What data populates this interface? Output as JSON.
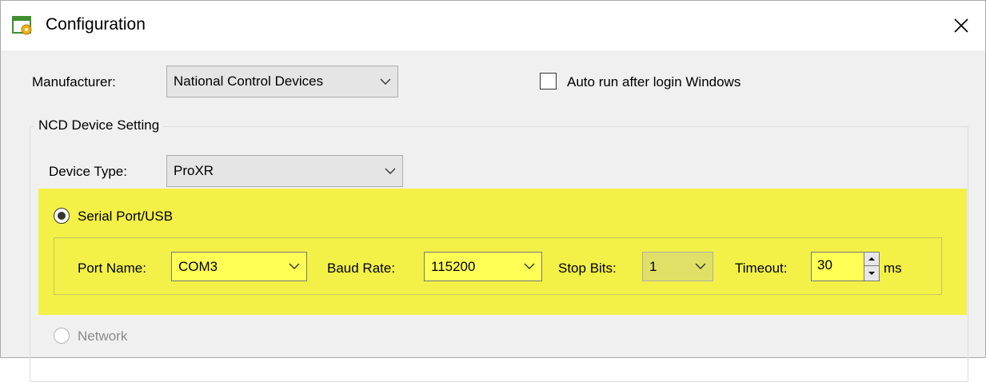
{
  "window": {
    "title": "Configuration"
  },
  "manufacturer": {
    "label": "Manufacturer:",
    "value": "National Control Devices"
  },
  "auto_run": {
    "label": "Auto run after login Windows",
    "checked": false
  },
  "ncd_group": {
    "legend": "NCD Device Setting"
  },
  "device_type": {
    "label": "Device Type:",
    "value": "ProXR"
  },
  "serial": {
    "radio_label": "Serial Port/USB",
    "selected": true,
    "highlight_color": "#f3f048",
    "port_name": {
      "label": "Port Name:",
      "value": "COM3"
    },
    "baud_rate": {
      "label": "Baud Rate:",
      "value": "115200"
    },
    "stop_bits": {
      "label": "Stop Bits:",
      "value": "1"
    },
    "timeout": {
      "label": "Timeout:",
      "value": "30",
      "unit": "ms"
    }
  },
  "network": {
    "radio_label": "Network",
    "selected": false,
    "enabled": false
  },
  "icons": [
    "app-config-icon",
    "close-icon",
    "chevron-down-icon",
    "spin-up-icon",
    "spin-down-icon"
  ]
}
